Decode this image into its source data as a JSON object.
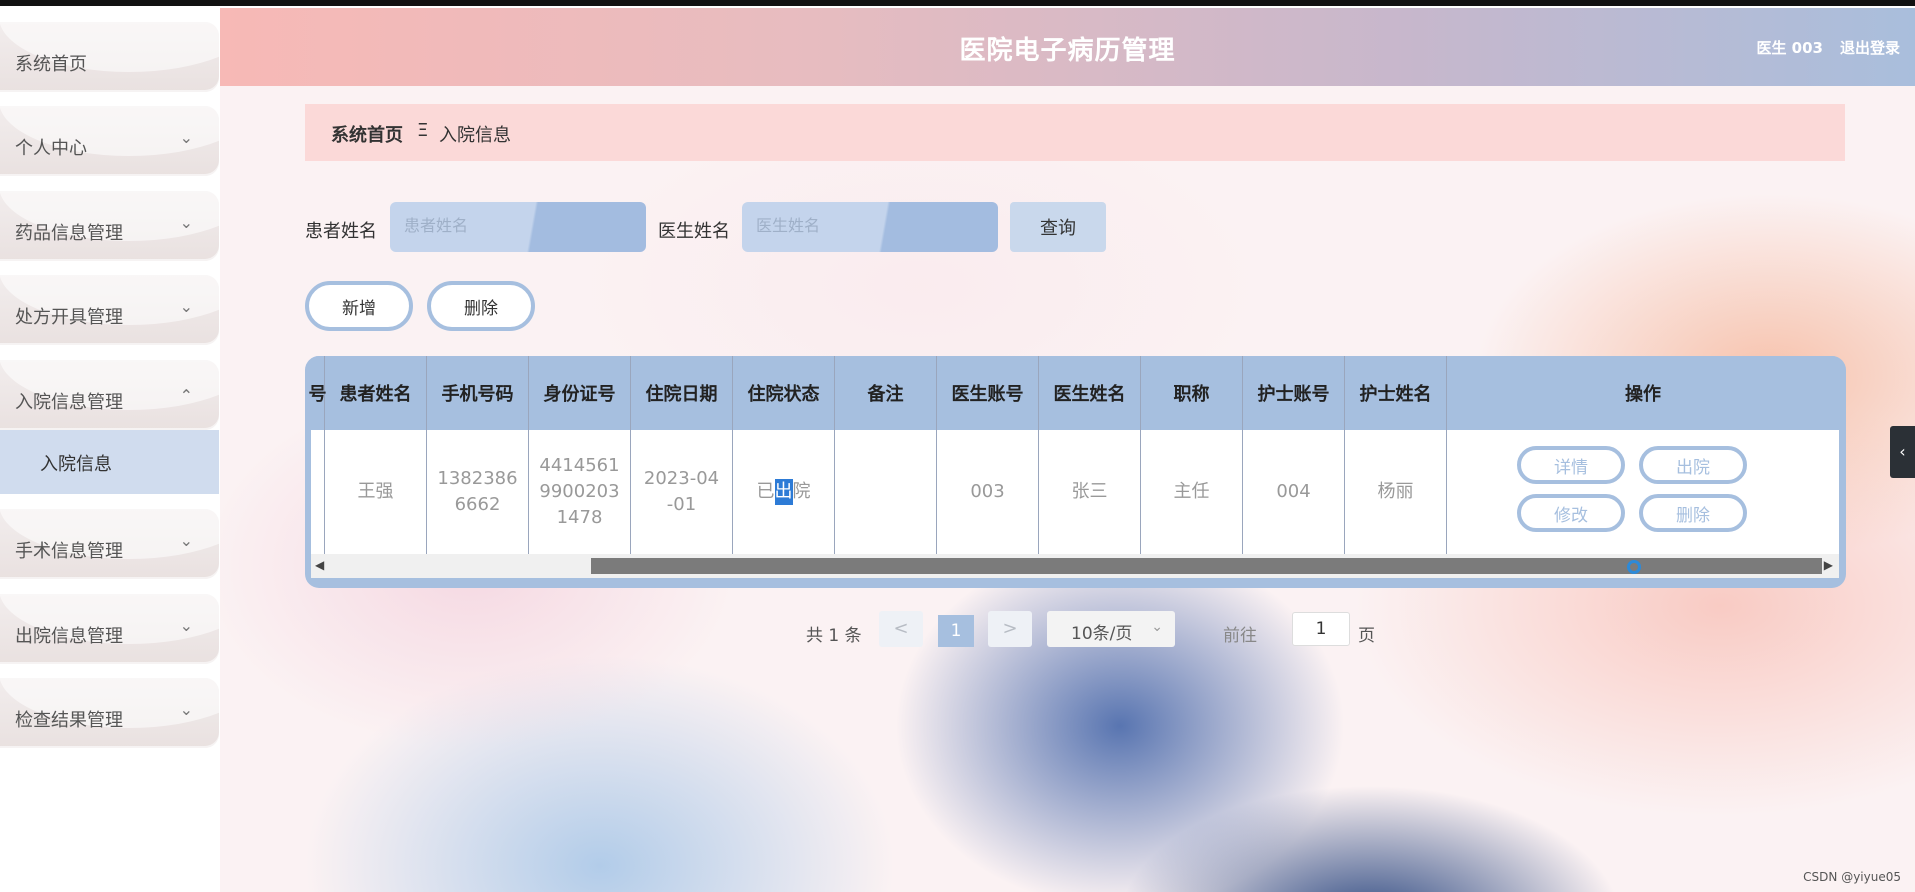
{
  "sidebar": {
    "items": [
      {
        "label": "系统首页"
      },
      {
        "label": "个人中心"
      },
      {
        "label": "药品信息管理"
      },
      {
        "label": "处方开具管理"
      },
      {
        "label": "入院信息管理"
      },
      {
        "label": "手术信息管理"
      },
      {
        "label": "出院信息管理"
      },
      {
        "label": "检查结果管理"
      }
    ],
    "sub_item": "入院信息"
  },
  "header": {
    "title": "医院电子病历管理",
    "user": "医生 003",
    "logout": "退出登录"
  },
  "breadcrumb": {
    "home": "系统首页",
    "separator": "Ξ",
    "current": "入院信息"
  },
  "search": {
    "patient_label": "患者姓名",
    "patient_placeholder": "患者姓名",
    "doctor_label": "医生姓名",
    "doctor_placeholder": "医生姓名",
    "query_label": "查询"
  },
  "actions": {
    "add_label": "新增",
    "delete_label": "删除"
  },
  "table": {
    "partial_header": "号",
    "columns": [
      "患者姓名",
      "手机号码",
      "身份证号",
      "住院日期",
      "住院状态",
      "备注",
      "医生账号",
      "医生姓名",
      "职称",
      "护士账号",
      "护士姓名",
      "操作"
    ],
    "row": {
      "patient_name": "王强",
      "phone_line1": "1382386",
      "phone_line2": "6662",
      "idcard_line1": "4414561",
      "idcard_line2": "9900203",
      "idcard_line3": "1478",
      "date_line1": "2023-04",
      "date_line2": "-01",
      "status_pre": "已",
      "status_hl": "出",
      "status_post": "院",
      "note": "",
      "doctor_account": "003",
      "doctor_name": "张三",
      "title": "主任",
      "nurse_account": "004",
      "nurse_name": "杨丽"
    },
    "ops": {
      "detail": "详情",
      "discharge": "出院",
      "edit": "修改",
      "delete": "删除"
    }
  },
  "pagination": {
    "total": "共 1 条",
    "prev": "<",
    "current_page": "1",
    "next": ">",
    "page_size": "10条/页",
    "goto_label": "前往",
    "goto_value": "1",
    "page_suffix": "页"
  },
  "watermark": "CSDN @yiyue05",
  "right_tab_icon": "‹"
}
